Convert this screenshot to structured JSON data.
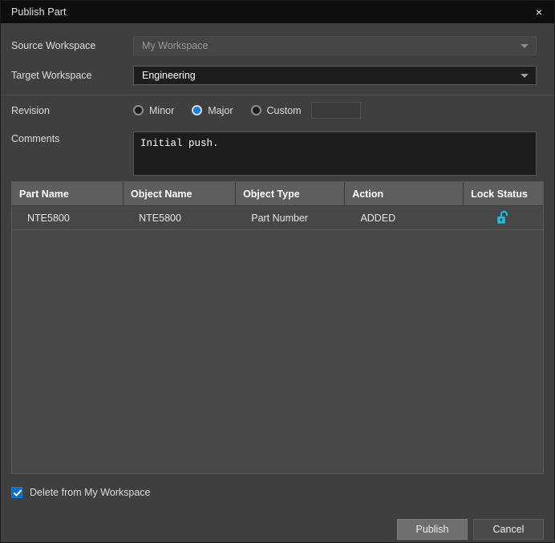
{
  "window": {
    "title": "Publish Part",
    "close_label": "×"
  },
  "form": {
    "source_workspace": {
      "label": "Source Workspace",
      "value": "My Workspace",
      "enabled": false
    },
    "target_workspace": {
      "label": "Target Workspace",
      "value": "Engineering",
      "enabled": true
    },
    "revision": {
      "label": "Revision",
      "options": [
        "Minor",
        "Major",
        "Custom"
      ],
      "selected": "Major",
      "custom_value": ""
    },
    "comments": {
      "label": "Comments",
      "value": "Initial push."
    }
  },
  "table": {
    "columns": [
      "Part Name",
      "Object Name",
      "Object Type",
      "Action",
      "Lock Status"
    ],
    "rows": [
      {
        "part_name": "NTE5800",
        "object_name": "NTE5800",
        "object_type": "Part Number",
        "action": "ADDED",
        "lock_status": "unlocked"
      }
    ]
  },
  "footer": {
    "delete_checkbox_label": "Delete from My Workspace",
    "delete_checkbox_checked": true,
    "publish_label": "Publish",
    "cancel_label": "Cancel"
  },
  "colors": {
    "accent": "#0a84e0",
    "lock_icon": "#1fbde0",
    "checkbox": "#0a6cc4",
    "window_bg": "#3f3f3f",
    "titlebar_bg": "#0d0d0d"
  }
}
